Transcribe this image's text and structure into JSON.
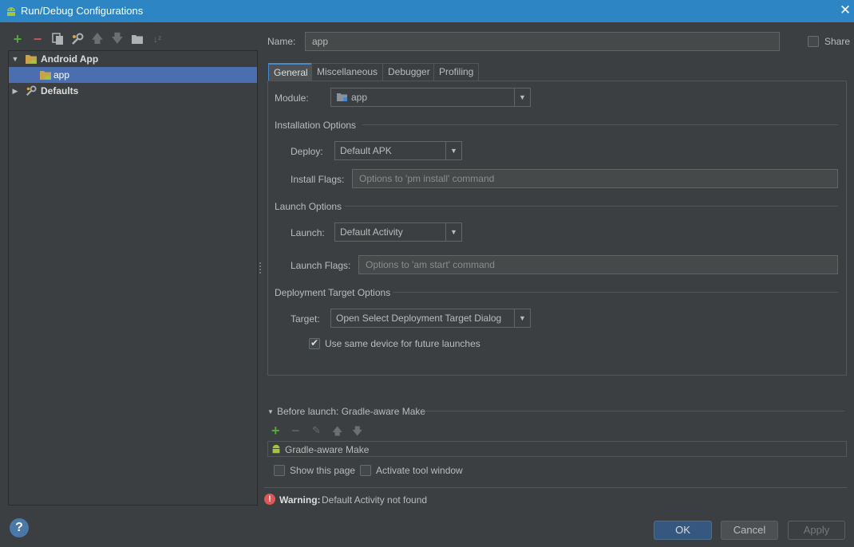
{
  "window": {
    "title": "Run/Debug Configurations"
  },
  "tree": {
    "items": [
      {
        "label": "Android App"
      },
      {
        "label": "app"
      },
      {
        "label": "Defaults"
      }
    ]
  },
  "name": {
    "label": "Name:",
    "value": "app"
  },
  "share": {
    "label": "Share"
  },
  "tabs": [
    {
      "label": "General"
    },
    {
      "label": "Miscellaneous"
    },
    {
      "label": "Debugger"
    },
    {
      "label": "Profiling"
    }
  ],
  "general": {
    "module_label": "Module:",
    "module_value": "app",
    "installation_header": "Installation Options",
    "deploy_label": "Deploy:",
    "deploy_value": "Default APK",
    "install_flags_label": "Install Flags:",
    "install_flags_placeholder": "Options to 'pm install' command",
    "launch_header": "Launch Options",
    "launch_label": "Launch:",
    "launch_value": "Default Activity",
    "launch_flags_label": "Launch Flags:",
    "launch_flags_placeholder": "Options to 'am start' command",
    "deployment_header": "Deployment Target Options",
    "target_label": "Target:",
    "target_value": "Open Select Deployment Target Dialog",
    "same_device_label": "Use same device for future launches"
  },
  "before_launch": {
    "header": "Before launch: Gradle-aware Make",
    "item": "Gradle-aware Make",
    "show_page_label": "Show this page",
    "activate_label": "Activate tool window"
  },
  "warning": {
    "prefix": "Warning:",
    "message": "Default Activity not found"
  },
  "buttons": {
    "ok": "OK",
    "cancel": "Cancel",
    "apply": "Apply"
  },
  "colors": {
    "titlebar": "#2d85c4",
    "selection": "#4b6eaf",
    "background": "#3c3f41",
    "add_green": "#55a840",
    "remove_red": "#c75450",
    "error_red": "#e05555"
  }
}
